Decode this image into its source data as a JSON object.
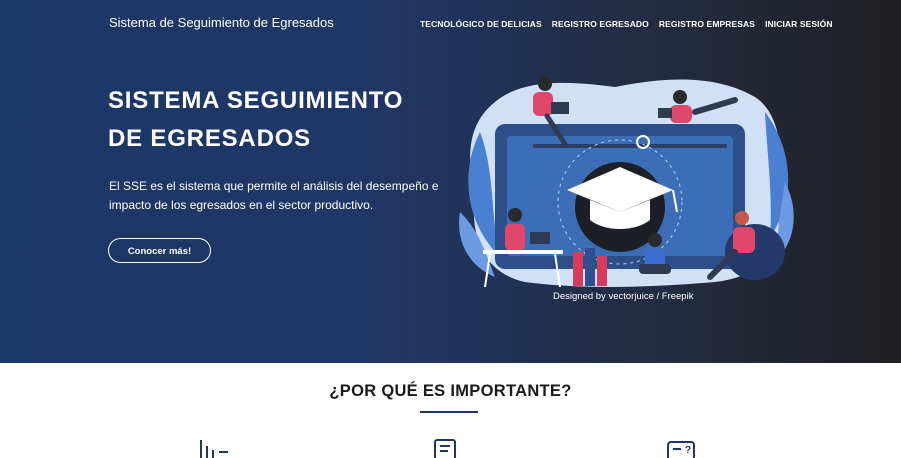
{
  "header": {
    "brand": "Sistema de Seguimiento de Egresados",
    "nav": [
      {
        "label": "TECNOLÓGICO DE DELICIAS"
      },
      {
        "label": "REGISTRO EGRESADO"
      },
      {
        "label": "REGISTRO EMPRESAS"
      },
      {
        "label": "INICIAR SESIÓN"
      }
    ]
  },
  "hero": {
    "title_line1": "SISTEMA SEGUIMIENTO",
    "title_line2": "DE EGRESADOS",
    "description": "El SSE es el sistema que permite el análisis del desempeño e impacto de los egresados en el sector productivo.",
    "cta_label": "Conocer más!",
    "credit": "Designed by vectorjuice / Freepik"
  },
  "section": {
    "title": "¿POR QUÉ ES IMPORTANTE?",
    "icons": [
      "chart-icon",
      "document-icon",
      "question-chat-icon"
    ]
  },
  "colors": {
    "hero_bg_left": "#1b3768",
    "hero_bg_right": "#1f1f22",
    "accent": "#1f3766",
    "illustration_blue": "#4a7fd1"
  }
}
